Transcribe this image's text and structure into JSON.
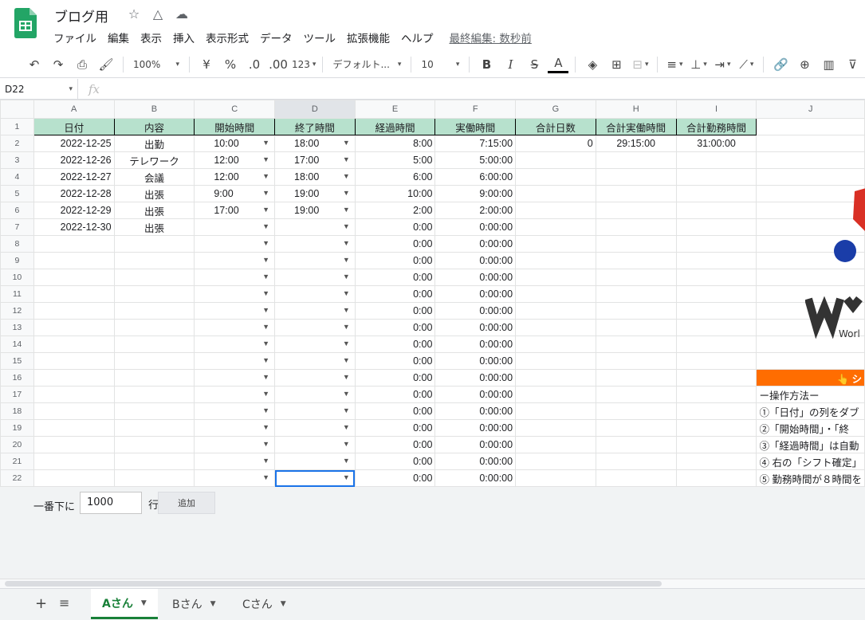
{
  "app": {
    "title": "ブログ用",
    "last_edit": "最終編集: 数秒前",
    "menus": [
      "ファイル",
      "編集",
      "表示",
      "挿入",
      "表示形式",
      "データ",
      "ツール",
      "拡張機能",
      "ヘルプ"
    ]
  },
  "toolbar": {
    "zoom": "100%",
    "currency": "¥",
    "percent": "%",
    "dec_decrease": ".0",
    "dec_increase": ".00",
    "number_format": "123",
    "font": "デフォルト...",
    "font_size": "10",
    "bold": "B",
    "italic": "I",
    "strike": "S",
    "text_color": "A"
  },
  "formula_bar": {
    "cell_ref": "D22",
    "fx": "fx",
    "value": ""
  },
  "columns": [
    "A",
    "B",
    "C",
    "D",
    "E",
    "F",
    "G",
    "H",
    "I",
    "J"
  ],
  "header_row": [
    "日付",
    "内容",
    "開始時間",
    "終了時間",
    "経過時間",
    "実働時間",
    "合計日数",
    "合計実働時間",
    "合計勤務時間"
  ],
  "rows": [
    {
      "n": "2",
      "a": "2022-12-25",
      "b": "出勤",
      "c": "10:00",
      "d": "18:00",
      "e": "8:00",
      "f": "7:15:00",
      "g": "0",
      "h": "29:15:00",
      "i": "31:00:00",
      "j": ""
    },
    {
      "n": "3",
      "a": "2022-12-26",
      "b": "テレワーク",
      "c": "12:00",
      "d": "17:00",
      "e": "5:00",
      "f": "5:00:00",
      "g": "",
      "h": "",
      "i": "",
      "j": ""
    },
    {
      "n": "4",
      "a": "2022-12-27",
      "b": "会議",
      "c": "12:00",
      "d": "18:00",
      "e": "6:00",
      "f": "6:00:00",
      "g": "",
      "h": "",
      "i": "",
      "j": ""
    },
    {
      "n": "5",
      "a": "2022-12-28",
      "b": "出張",
      "c": "9:00",
      "d": "19:00",
      "e": "10:00",
      "f": "9:00:00",
      "g": "",
      "h": "",
      "i": "",
      "j": ""
    },
    {
      "n": "6",
      "a": "2022-12-29",
      "b": "出張",
      "c": "17:00",
      "d": "19:00",
      "e": "2:00",
      "f": "2:00:00",
      "g": "",
      "h": "",
      "i": "",
      "j": ""
    },
    {
      "n": "7",
      "a": "2022-12-30",
      "b": "出張",
      "c": "",
      "d": "",
      "e": "0:00",
      "f": "0:00:00",
      "g": "",
      "h": "",
      "i": "",
      "j": ""
    },
    {
      "n": "8",
      "a": "",
      "b": "",
      "c": "",
      "d": "",
      "e": "0:00",
      "f": "0:00:00",
      "g": "",
      "h": "",
      "i": "",
      "j": ""
    },
    {
      "n": "9",
      "a": "",
      "b": "",
      "c": "",
      "d": "",
      "e": "0:00",
      "f": "0:00:00",
      "g": "",
      "h": "",
      "i": "",
      "j": ""
    },
    {
      "n": "10",
      "a": "",
      "b": "",
      "c": "",
      "d": "",
      "e": "0:00",
      "f": "0:00:00",
      "g": "",
      "h": "",
      "i": "",
      "j": ""
    },
    {
      "n": "11",
      "a": "",
      "b": "",
      "c": "",
      "d": "",
      "e": "0:00",
      "f": "0:00:00",
      "g": "",
      "h": "",
      "i": "",
      "j": ""
    },
    {
      "n": "12",
      "a": "",
      "b": "",
      "c": "",
      "d": "",
      "e": "0:00",
      "f": "0:00:00",
      "g": "",
      "h": "",
      "i": "",
      "j": ""
    },
    {
      "n": "13",
      "a": "",
      "b": "",
      "c": "",
      "d": "",
      "e": "0:00",
      "f": "0:00:00",
      "g": "",
      "h": "",
      "i": "",
      "j": ""
    },
    {
      "n": "14",
      "a": "",
      "b": "",
      "c": "",
      "d": "",
      "e": "0:00",
      "f": "0:00:00",
      "g": "",
      "h": "",
      "i": "",
      "j": ""
    },
    {
      "n": "15",
      "a": "",
      "b": "",
      "c": "",
      "d": "",
      "e": "0:00",
      "f": "0:00:00",
      "g": "",
      "h": "",
      "i": "",
      "j": ""
    },
    {
      "n": "16",
      "a": "",
      "b": "",
      "c": "",
      "d": "",
      "e": "0:00",
      "f": "0:00:00",
      "g": "",
      "h": "",
      "i": "",
      "j": "👆 シ"
    },
    {
      "n": "17",
      "a": "",
      "b": "",
      "c": "",
      "d": "",
      "e": "0:00",
      "f": "0:00:00",
      "g": "",
      "h": "",
      "i": "",
      "j": "ー操作方法ー"
    },
    {
      "n": "18",
      "a": "",
      "b": "",
      "c": "",
      "d": "",
      "e": "0:00",
      "f": "0:00:00",
      "g": "",
      "h": "",
      "i": "",
      "j": "①「日付」の列をダブ"
    },
    {
      "n": "19",
      "a": "",
      "b": "",
      "c": "",
      "d": "",
      "e": "0:00",
      "f": "0:00:00",
      "g": "",
      "h": "",
      "i": "",
      "j": "②「開始時間」・「終"
    },
    {
      "n": "20",
      "a": "",
      "b": "",
      "c": "",
      "d": "",
      "e": "0:00",
      "f": "0:00:00",
      "g": "",
      "h": "",
      "i": "",
      "j": "③「経過時間」は自動"
    },
    {
      "n": "21",
      "a": "",
      "b": "",
      "c": "",
      "d": "",
      "e": "0:00",
      "f": "0:00:00",
      "g": "",
      "h": "",
      "i": "",
      "j": "④ 右の「シフト確定」"
    },
    {
      "n": "22",
      "a": "",
      "b": "",
      "c": "",
      "d": "",
      "e": "0:00",
      "f": "0:00:00",
      "g": "",
      "h": "",
      "i": "",
      "j": "⑤ 勤務時間が８時間を"
    }
  ],
  "logo_text": "Worl",
  "add_rows": {
    "label": "一番下に",
    "count": "1000",
    "unit": "行",
    "button": "追加"
  },
  "sheet_tabs": [
    "Aさん",
    "Bさん",
    "Cさん"
  ],
  "colors": {
    "header_green": "#b7e1cd",
    "accent_orange": "#ff6d01",
    "selection_blue": "#1a73e8",
    "active_tab": "#188038"
  }
}
